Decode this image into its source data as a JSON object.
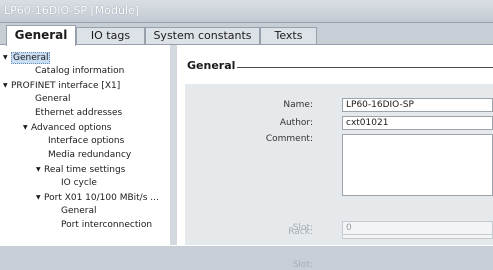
{
  "window": {
    "title": "LP60-16DIO-SP [Module]"
  },
  "tabs": [
    {
      "label": "General",
      "active": true
    },
    {
      "label": "IO tags",
      "active": false
    },
    {
      "label": "System constants",
      "active": false
    },
    {
      "label": "Texts",
      "active": false
    }
  ],
  "tree": [
    {
      "label": "General",
      "expanded": true,
      "selected": true
    },
    {
      "label": "Catalog information"
    },
    {
      "label": "PROFINET interface [X1]",
      "expanded": true
    },
    {
      "label": "General"
    },
    {
      "label": "Ethernet addresses"
    },
    {
      "label": "Advanced options",
      "expanded": true
    },
    {
      "label": "Interface options"
    },
    {
      "label": "Media redundancy"
    },
    {
      "label": "Real time settings",
      "expanded": true
    },
    {
      "label": "IO cycle"
    },
    {
      "label": "Port X01 10/100 MBit/s ...",
      "expanded": true
    },
    {
      "label": "General"
    },
    {
      "label": "Port interconnection"
    }
  ],
  "section": {
    "title": "General"
  },
  "form": {
    "name_label": "Name:",
    "name_value": "LP60-16DIO-SP",
    "author_label": "Author:",
    "author_value": "cxt01021",
    "comment_label": "Comment:",
    "comment_value": "",
    "rack_label": "Rack:",
    "rack_value": "0",
    "slot_label": "Slot:",
    "slot_value": "0"
  },
  "colors": {
    "selection": "#c8dcf2",
    "titlebar_text": "#ffffff"
  }
}
